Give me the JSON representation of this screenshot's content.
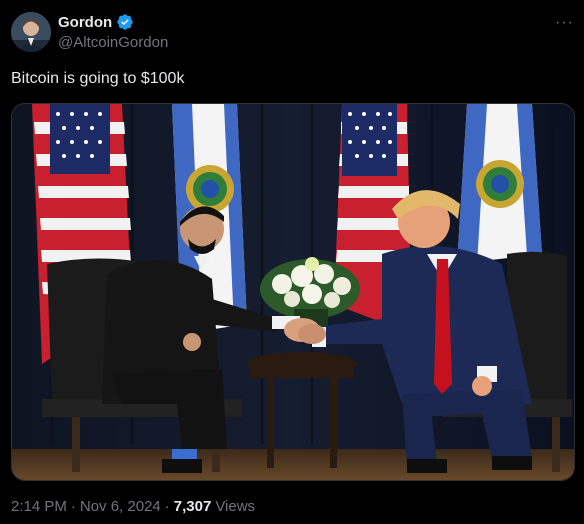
{
  "author": {
    "display_name": "Gordon",
    "handle": "@AltcoinGordon",
    "verified": true
  },
  "icons": {
    "avatar": "profile-photo",
    "verified": "verified-badge-icon",
    "more": "more-options-icon"
  },
  "more_glyph": "···",
  "tweet": {
    "text": "Bitcoin is going to $100k"
  },
  "media": {
    "alt": "photo"
  },
  "meta": {
    "time": "2:14 PM",
    "sep1": "·",
    "date": "Nov 6, 2024",
    "sep2": "·",
    "views_count": "7,307",
    "views_label": "Views"
  },
  "colors": {
    "background": "#000000",
    "text_primary": "#e7e9ea",
    "text_secondary": "#71767b",
    "verified_blue": "#1d9bf0"
  }
}
